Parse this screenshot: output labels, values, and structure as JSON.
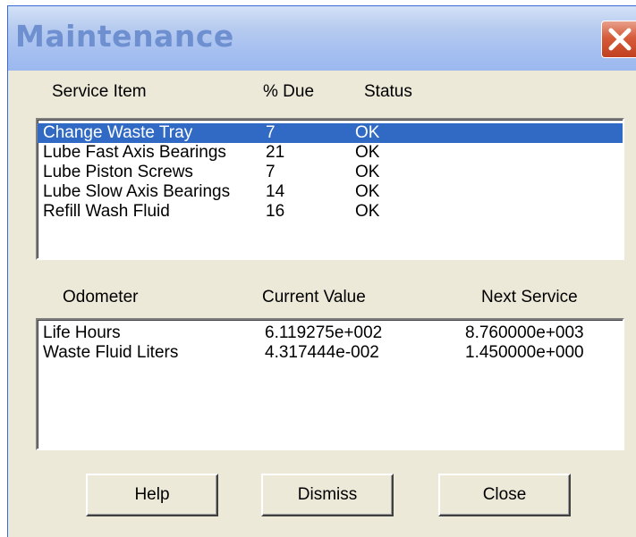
{
  "window": {
    "title": "Maintenance"
  },
  "services": {
    "headers": {
      "item": "Service Item",
      "due": "% Due",
      "status": "Status"
    },
    "rows": [
      {
        "item": "Change Waste Tray",
        "due": "7",
        "status": "OK"
      },
      {
        "item": "Lube Fast Axis Bearings",
        "due": "21",
        "status": "OK"
      },
      {
        "item": "Lube Piston Screws",
        "due": "7",
        "status": "OK"
      },
      {
        "item": "Lube Slow Axis Bearings",
        "due": "14",
        "status": "OK"
      },
      {
        "item": "Refill Wash Fluid",
        "due": "16",
        "status": "OK"
      }
    ],
    "selected_index": 0
  },
  "odometer": {
    "headers": {
      "name": "Odometer",
      "current": "Current Value",
      "next": "Next Service"
    },
    "rows": [
      {
        "name": "Life Hours",
        "current": "6.119275e+002",
        "next": "8.760000e+003"
      },
      {
        "name": "Waste Fluid Liters",
        "current": "4.317444e-002",
        "next": "1.450000e+000"
      }
    ]
  },
  "buttons": {
    "help": "Help",
    "dismiss": "Dismiss",
    "close": "Close"
  },
  "colors": {
    "selection": "#316ac5",
    "dialog_bg": "#ece9d8",
    "close_button": "#d65c3b"
  }
}
